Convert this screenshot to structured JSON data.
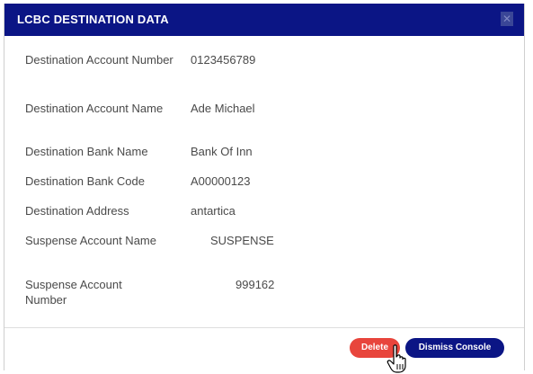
{
  "modal": {
    "title": "LCBC DESTINATION DATA",
    "close_icon": "close-icon"
  },
  "details": [
    {
      "label": "Destination Account Number",
      "value": "0123456789"
    },
    {
      "label": "Destination Account Name",
      "value": "Ade Michael"
    },
    {
      "label": "Destination Bank Name",
      "value": "Bank Of Inn"
    },
    {
      "label": "Destination Bank Code",
      "value": "A00000123"
    },
    {
      "label": "Destination Address",
      "value": "antartica"
    },
    {
      "label": "Suspense Account Name",
      "value": "SUSPENSE"
    },
    {
      "label": "Suspense Account Number",
      "value": "999162"
    }
  ],
  "footer": {
    "delete_label": "Delete",
    "dismiss_label": "Dismiss Console"
  },
  "colors": {
    "header_bg": "#0b1585",
    "delete_bg": "#e8453c",
    "dismiss_bg": "#0b1585"
  },
  "cursor": "hand-pointer-icon"
}
